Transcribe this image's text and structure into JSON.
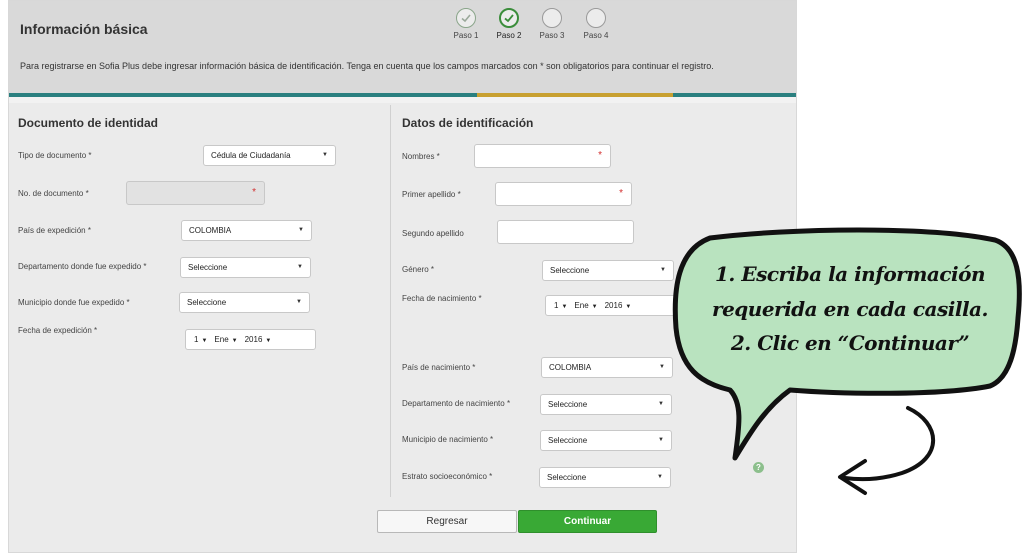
{
  "header": {
    "title": "Información básica",
    "intro": "Para registrarse en Sofia Plus debe ingresar información básica de identificación. Tenga en cuenta que los campos marcados con * son obligatorios para continuar el registro.",
    "steps": [
      {
        "label": "Paso 1",
        "state": "done"
      },
      {
        "label": "Paso 2",
        "state": "current"
      },
      {
        "label": "Paso 3",
        "state": "pending"
      },
      {
        "label": "Paso 4",
        "state": "pending"
      }
    ],
    "bar_colors": [
      "#2a7f7f",
      "#c8a030",
      "#2a7f7f"
    ]
  },
  "left": {
    "section_title": "Documento de identidad",
    "tipo_label": "Tipo de documento *",
    "tipo_value": "Cédula de Ciudadanía",
    "numdoc_label": "No. de documento *",
    "pais_label": "País de expedición *",
    "pais_value": "COLOMBIA",
    "depto_label": "Departamento donde fue expedido *",
    "depto_value": "Seleccione",
    "muni_label": "Municipio donde fue expedido *",
    "muni_value": "Seleccione",
    "fecha_label": "Fecha de expedición *",
    "fecha_day": "1",
    "fecha_month": "Ene",
    "fecha_year": "2016"
  },
  "right": {
    "section_title": "Datos de identificación",
    "nombres_label": "Nombres *",
    "apellido1_label": "Primer apellido *",
    "apellido2_label": "Segundo apellido",
    "genero_label": "Género *",
    "genero_value": "Seleccione",
    "nac_label": "Fecha de nacimiento *",
    "nac_day": "1",
    "nac_month": "Ene",
    "nac_year": "2016",
    "pais_label": "País de nacimiento *",
    "pais_value": "COLOMBIA",
    "depto_label": "Departamento de nacimiento *",
    "depto_value": "Seleccione",
    "muni_label": "Municipio de nacimiento *",
    "muni_value": "Seleccione",
    "estrato_label": "Estrato socioeconómico *",
    "estrato_value": "Seleccione"
  },
  "buttons": {
    "back": "Regresar",
    "next": "Continuar"
  },
  "help_icon": "?",
  "callout": {
    "line1": "1. Escriba la información",
    "line2": "requerida en cada casilla.",
    "line3": "2. Clic en “Continuar”",
    "fill_color": "#b9e3bf"
  }
}
